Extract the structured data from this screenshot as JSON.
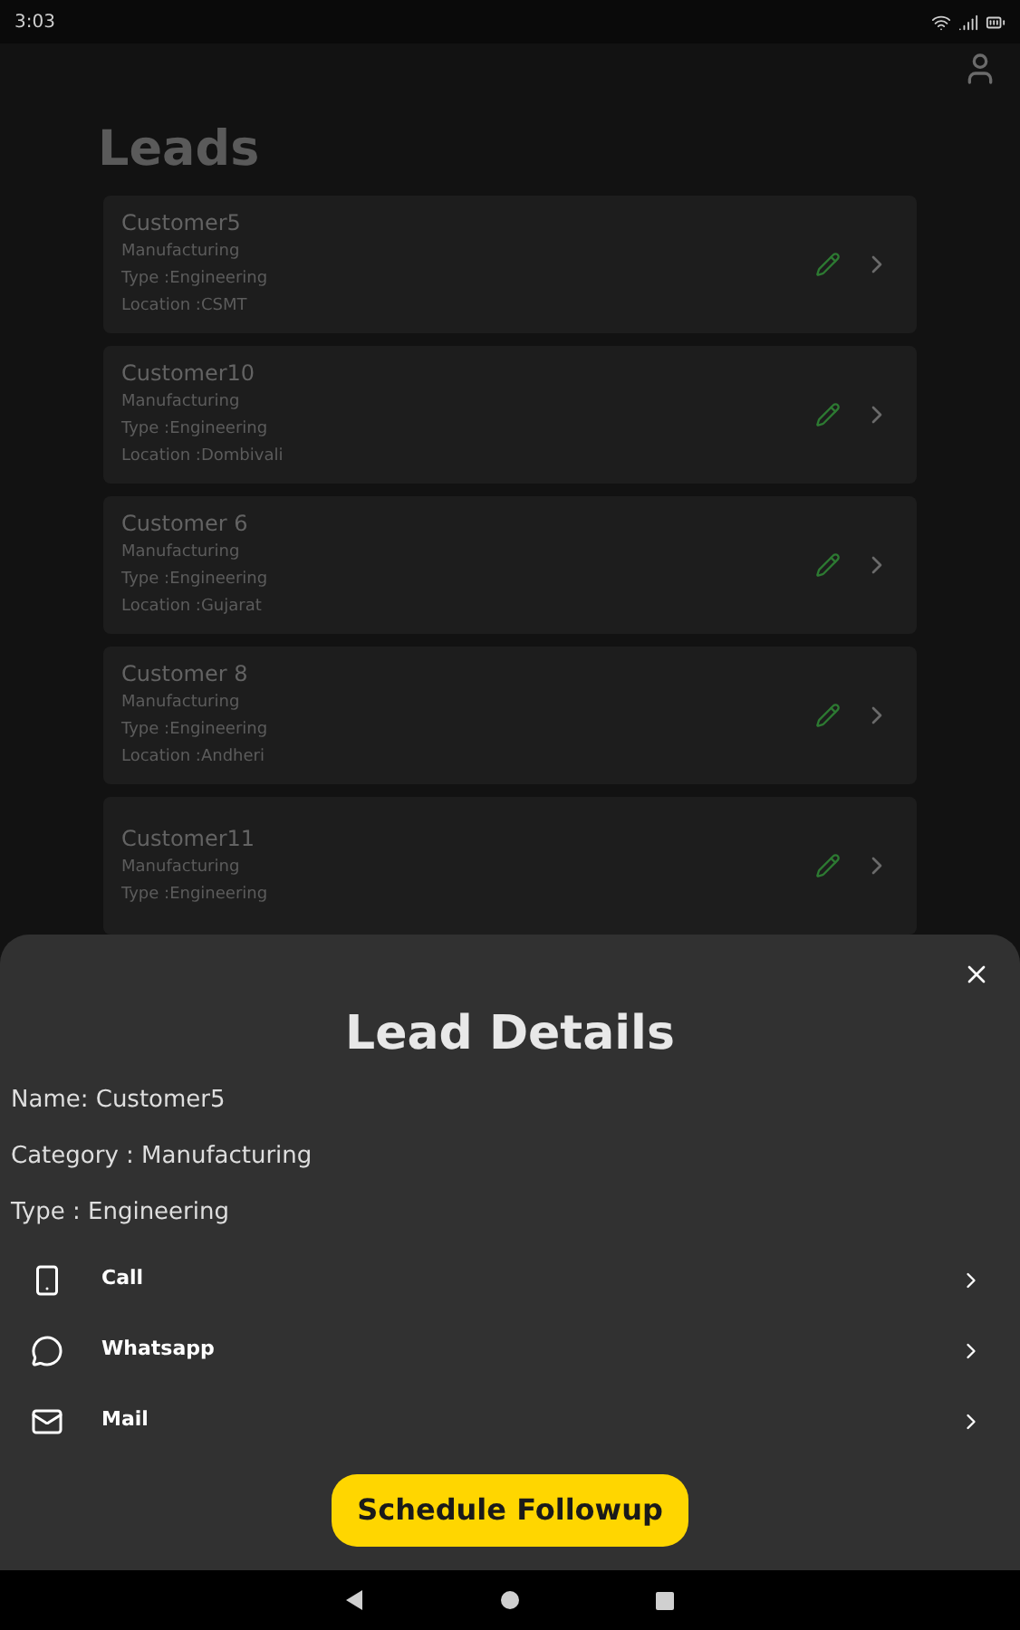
{
  "status_bar": {
    "time": "3:03"
  },
  "page": {
    "title": "Leads"
  },
  "leads": [
    {
      "name": "Customer5",
      "category": "Manufacturing",
      "type": "Type :Engineering",
      "location": "Location :CSMT"
    },
    {
      "name": "Customer10",
      "category": "Manufacturing",
      "type": "Type :Engineering",
      "location": "Location :Dombivali"
    },
    {
      "name": "Customer 6",
      "category": "Manufacturing",
      "type": "Type :Engineering",
      "location": "Location :Gujarat"
    },
    {
      "name": "Customer 8",
      "category": "Manufacturing",
      "type": "Type :Engineering",
      "location": "Location :Andheri"
    },
    {
      "name": "Customer11",
      "category": "Manufacturing",
      "type": "Type :Engineering"
    }
  ],
  "sheet": {
    "title": "Lead Details",
    "fields": [
      "Name: Customer5",
      "Category : Manufacturing",
      "Type : Engineering"
    ],
    "actions": [
      {
        "kind": "phone",
        "label": "Call"
      },
      {
        "kind": "whatsapp",
        "label": "Whatsapp"
      },
      {
        "kind": "mail",
        "label": "Mail"
      }
    ],
    "button": "Schedule Followup"
  }
}
